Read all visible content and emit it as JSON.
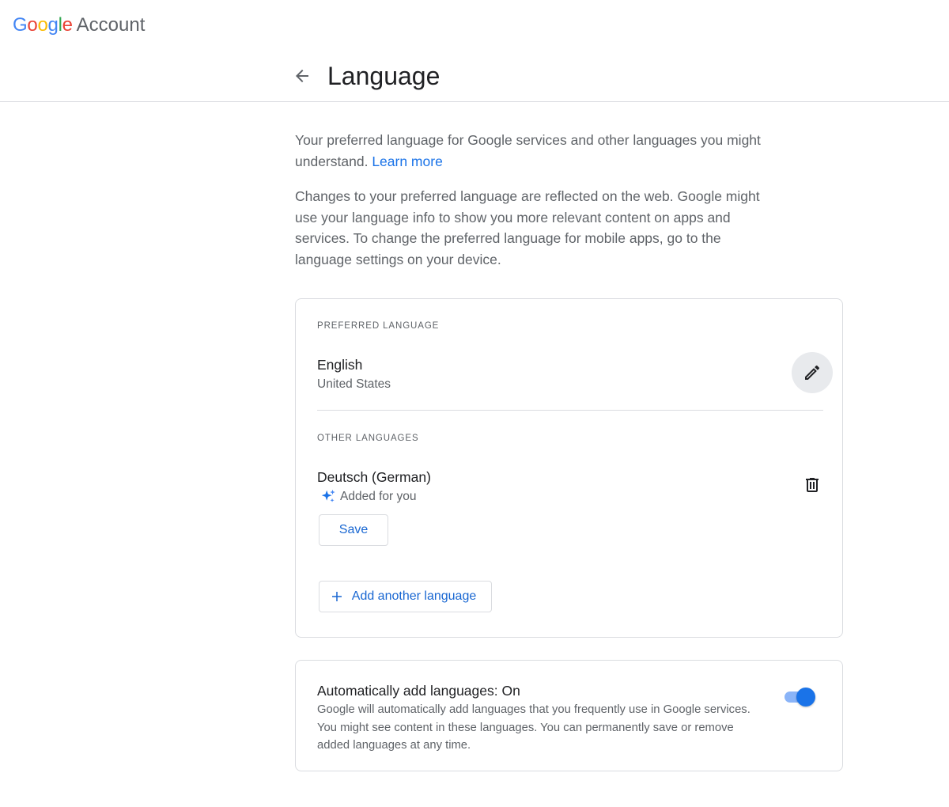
{
  "header": {
    "logo_letters": [
      "G",
      "o",
      "o",
      "g",
      "l",
      "e"
    ],
    "logo_colors": [
      "#4285F4",
      "#EA4335",
      "#FBBC05",
      "#4285F4",
      "#34A853",
      "#EA4335"
    ],
    "logo_suffix": "Account",
    "page_title": "Language"
  },
  "intro": {
    "paragraph1": "Your preferred language for Google services and other languages you might understand.",
    "learn_more": "Learn more",
    "paragraph2": "Changes to your preferred language are reflected on the web. Google might use your language info to show you more relevant content on apps and services. To change the preferred language for mobile apps, go to the language settings on your device."
  },
  "preferred": {
    "section_label": "PREFERRED LANGUAGE",
    "language": "English",
    "region": "United States",
    "edit_icon": "pencil-icon"
  },
  "other": {
    "section_label": "OTHER LANGUAGES",
    "language": "Deutsch (German)",
    "added_label": "Added for you",
    "sparkle_icon": "sparkle-icon",
    "delete_icon": "trash-icon",
    "save_label": "Save",
    "add_label": "Add another language"
  },
  "auto_add": {
    "title": "Automatically add languages: On",
    "description": "Google will automatically add languages that you frequently use in Google services. You might see content in these languages. You can permanently save or remove added languages at any time.",
    "enabled": true
  },
  "colors": {
    "accent": "#1a73e8",
    "link": "#1a73e8",
    "toggle_track": "#8ab4f8"
  }
}
